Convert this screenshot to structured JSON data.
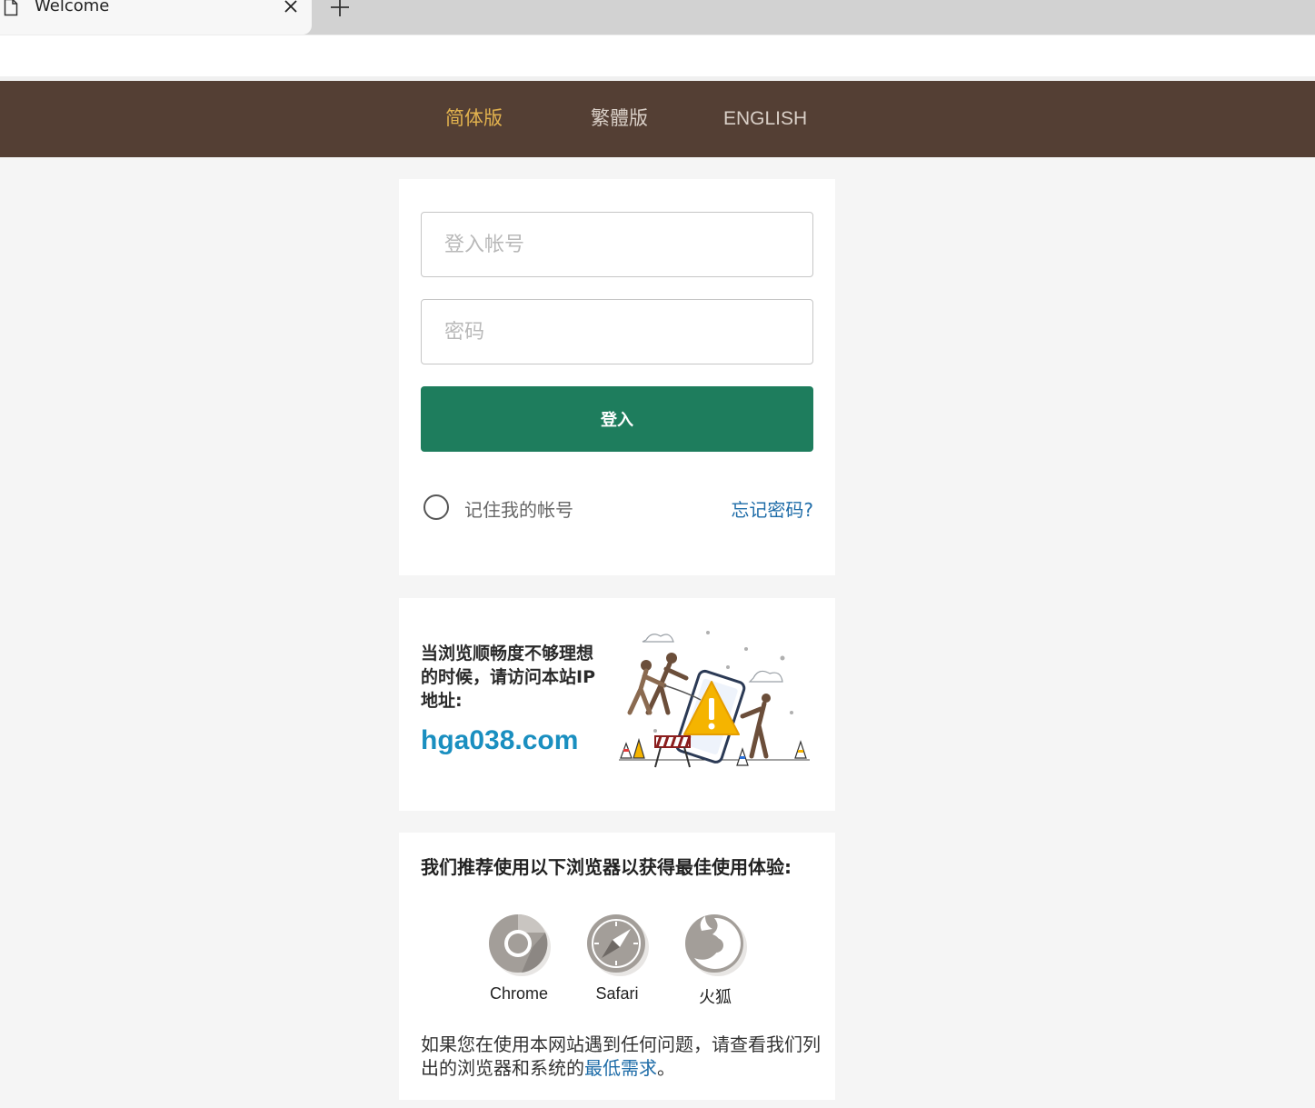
{
  "browser": {
    "tab_title": "Welcome"
  },
  "header": {
    "languages": [
      {
        "label": "简体版",
        "active": true
      },
      {
        "label": "繁體版",
        "active": false
      },
      {
        "label": "ENGLISH",
        "active": false
      }
    ]
  },
  "login": {
    "username_placeholder": "登入帐号",
    "password_placeholder": "密码",
    "submit_label": "登入",
    "remember_label": "记住我的帐号",
    "forgot_label": "忘记密码?"
  },
  "ip_notice": {
    "text": "当浏览顺畅度不够理想的时候，请访问本站IP地址:",
    "domain": "hga038.com",
    "illustration_icon": "maintenance-warning-illustration"
  },
  "browsers": {
    "title": "我们推荐使用以下浏览器以获得最佳使用体验:",
    "items": [
      {
        "label": "Chrome",
        "icon": "chrome-icon"
      },
      {
        "label": "Safari",
        "icon": "safari-icon"
      },
      {
        "label": "火狐",
        "icon": "firefox-icon"
      }
    ],
    "note_prefix": "如果您在使用本网站遇到任何问题，请查看我们列出的浏览器和系统的",
    "note_link": "最低需求",
    "note_suffix": "。"
  },
  "colors": {
    "header_bg": "#543f34",
    "active_language": "#e2b24e",
    "login_button": "#1e7d5d",
    "link": "#1e6ca8",
    "domain": "#1a8fc0"
  }
}
